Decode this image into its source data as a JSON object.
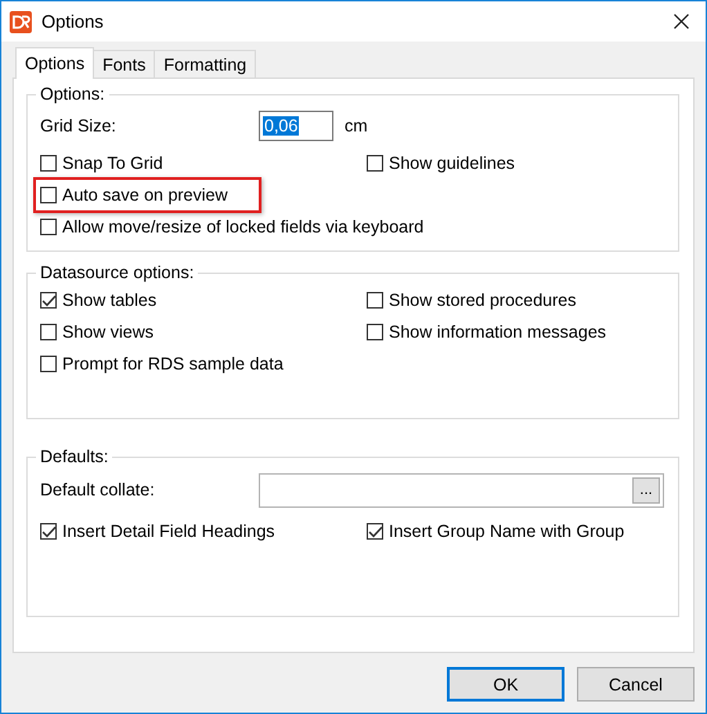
{
  "window": {
    "title": "Options"
  },
  "tabs": [
    {
      "label": "Options",
      "selected": true
    },
    {
      "label": "Fonts",
      "selected": false
    },
    {
      "label": "Formatting",
      "selected": false
    }
  ],
  "options_group": {
    "title": "Options:",
    "grid_size": {
      "label": "Grid Size:",
      "value": "0,06",
      "unit": "cm"
    },
    "checkboxes": [
      {
        "label": "Snap To Grid",
        "checked": false,
        "highlighted": false
      },
      {
        "label": "Show guidelines",
        "checked": false,
        "highlighted": false
      },
      {
        "label": "Auto save on preview",
        "checked": false,
        "highlighted": true
      },
      {
        "label": "Allow move/resize of locked fields via keyboard",
        "checked": false,
        "highlighted": false
      }
    ]
  },
  "datasource_group": {
    "title": "Datasource options:",
    "checkboxes": [
      {
        "label": "Show tables",
        "checked": true
      },
      {
        "label": "Show stored procedures",
        "checked": false
      },
      {
        "label": "Show views",
        "checked": false
      },
      {
        "label": "Show information messages",
        "checked": false
      },
      {
        "label": "Prompt for RDS sample data",
        "checked": false
      }
    ]
  },
  "defaults_group": {
    "title": "Defaults:",
    "collate": {
      "label": "Default collate:",
      "button": "..."
    },
    "checkboxes": [
      {
        "label": "Insert Detail Field Headings",
        "checked": true
      },
      {
        "label": "Insert Group Name with Group",
        "checked": true
      }
    ]
  },
  "buttons": [
    {
      "label": "OK",
      "default": true
    },
    {
      "label": "Cancel",
      "default": false
    }
  ]
}
